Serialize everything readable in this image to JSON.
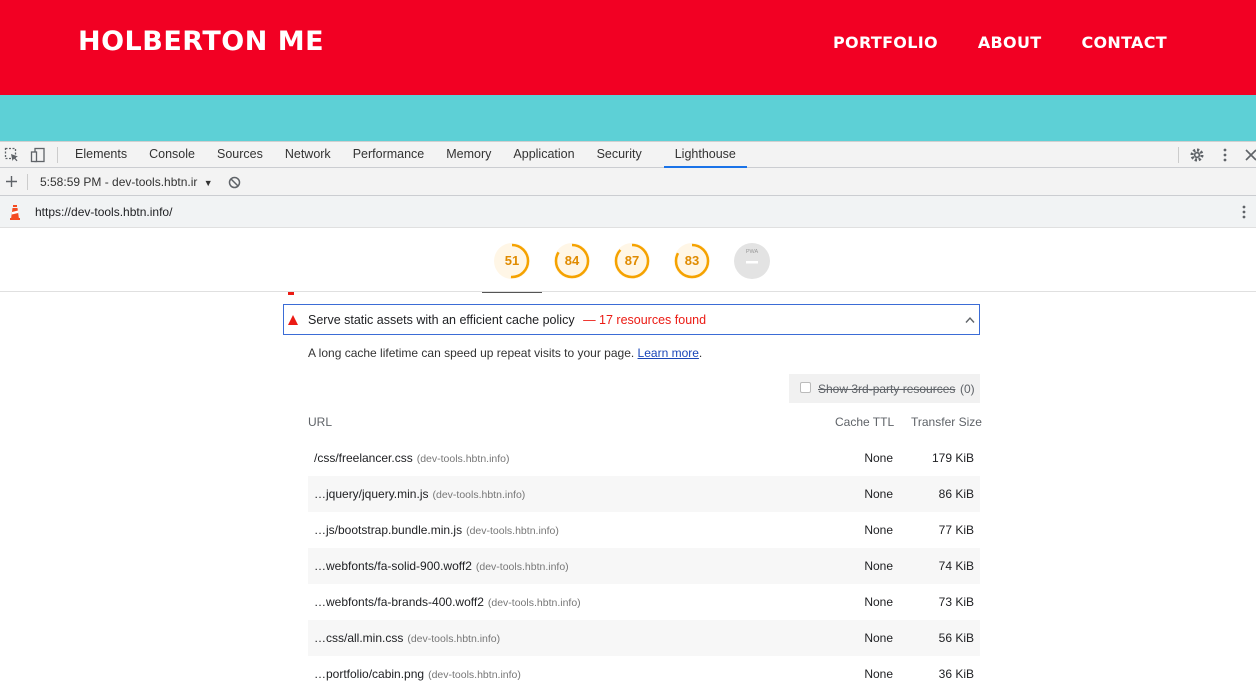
{
  "site": {
    "brand": "HOLBERTON ME",
    "nav": [
      "PORTFOLIO",
      "ABOUT",
      "CONTACT"
    ],
    "colors": {
      "header": "#f20023",
      "band": "#5dd0d6"
    }
  },
  "devtools": {
    "tabs": [
      "Elements",
      "Console",
      "Sources",
      "Network",
      "Performance",
      "Memory",
      "Application",
      "Security",
      "Lighthouse"
    ],
    "active_tab": "Lighthouse",
    "report_select": "5:58:59 PM - dev-tools.hbtn.ir",
    "url": "https://dev-tools.hbtn.info/"
  },
  "scores": [
    {
      "value": "51",
      "fraction": 0.51
    },
    {
      "value": "84",
      "fraction": 0.84
    },
    {
      "value": "87",
      "fraction": 0.87
    },
    {
      "value": "83",
      "fraction": 0.83
    }
  ],
  "pwa_label": "PWA",
  "audit": {
    "title": "Serve static assets with an efficient cache policy",
    "display_value": "— 17 resources found",
    "description": "A long cache lifetime can speed up repeat visits to your page.",
    "learn_more": "Learn more",
    "third_party_label": "Show 3rd-party resources",
    "third_party_count": "(0)",
    "columns": {
      "url": "URL",
      "ttl": "Cache TTL",
      "size": "Transfer Size"
    },
    "rows": [
      {
        "url": "/css/freelancer.css",
        "host": "(dev-tools.hbtn.info)",
        "ttl": "None",
        "size": "179 KiB"
      },
      {
        "url": "…jquery/jquery.min.js",
        "host": "(dev-tools.hbtn.info)",
        "ttl": "None",
        "size": "86 KiB"
      },
      {
        "url": "…js/bootstrap.bundle.min.js",
        "host": "(dev-tools.hbtn.info)",
        "ttl": "None",
        "size": "77 KiB"
      },
      {
        "url": "…webfonts/fa-solid-900.woff2",
        "host": "(dev-tools.hbtn.info)",
        "ttl": "None",
        "size": "74 KiB"
      },
      {
        "url": "…webfonts/fa-brands-400.woff2",
        "host": "(dev-tools.hbtn.info)",
        "ttl": "None",
        "size": "73 KiB"
      },
      {
        "url": "…css/all.min.css",
        "host": "(dev-tools.hbtn.info)",
        "ttl": "None",
        "size": "56 KiB"
      },
      {
        "url": "…portfolio/cabin.png",
        "host": "(dev-tools.hbtn.info)",
        "ttl": "None",
        "size": "36 KiB"
      }
    ]
  }
}
